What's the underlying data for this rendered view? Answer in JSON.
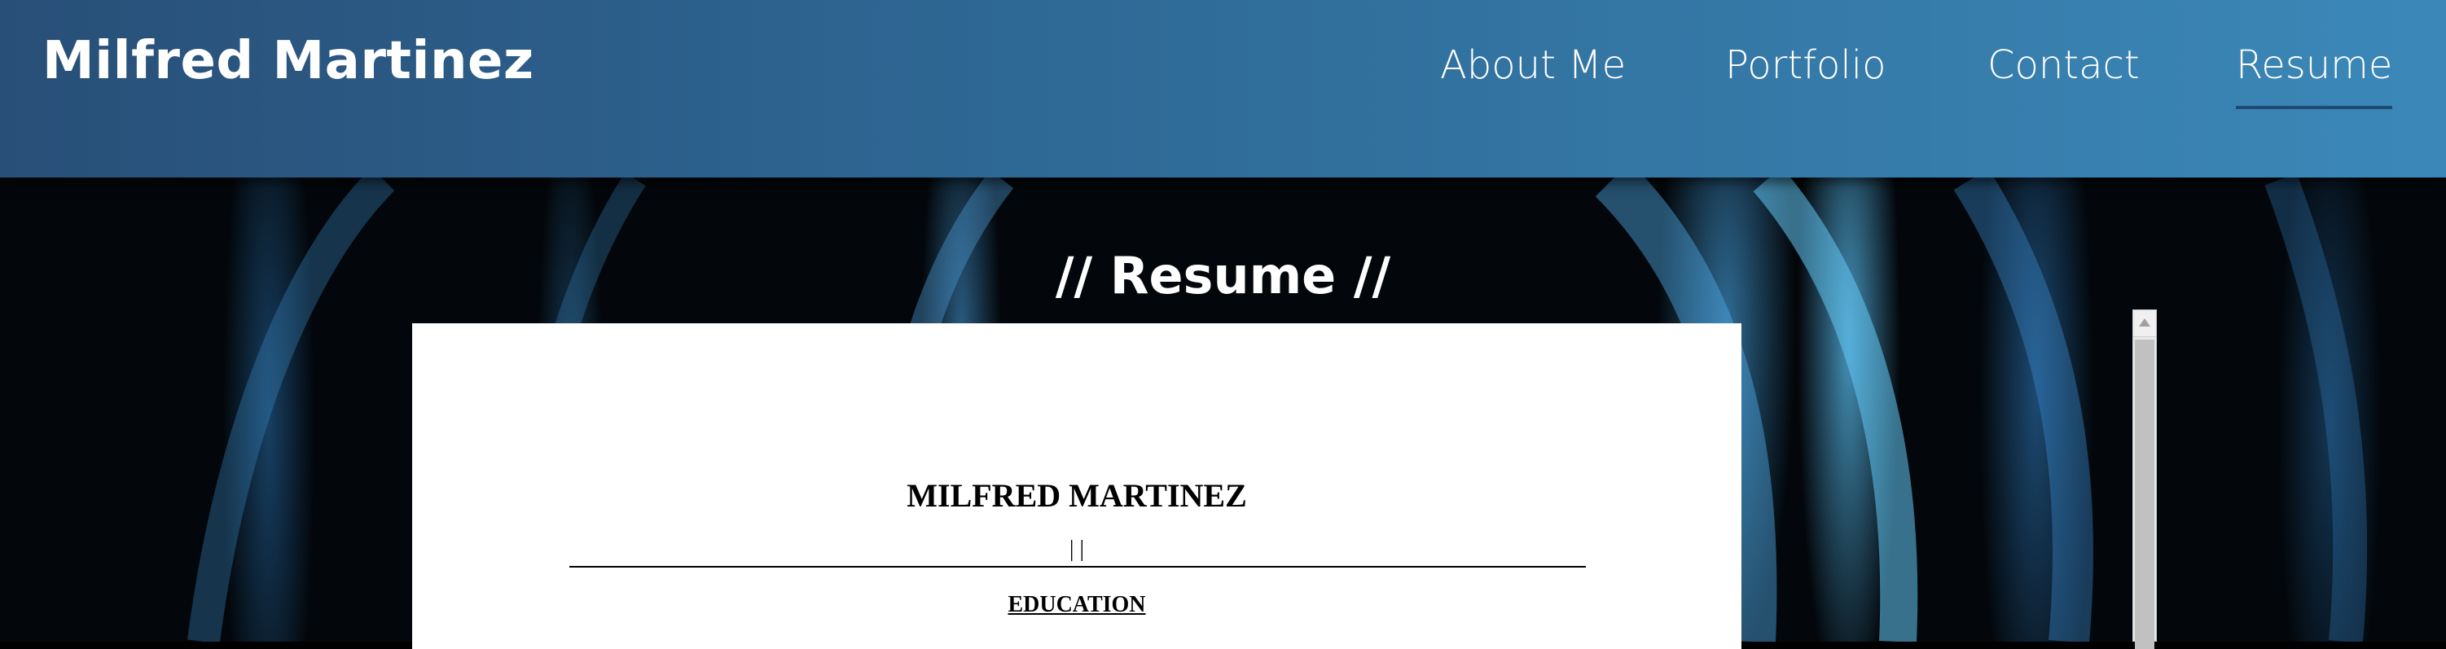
{
  "header": {
    "brand": "Milfred Martinez",
    "nav": [
      {
        "label": "About Me",
        "active": false
      },
      {
        "label": "Portfolio",
        "active": false
      },
      {
        "label": "Contact",
        "active": false
      },
      {
        "label": "Resume",
        "active": true
      }
    ]
  },
  "main": {
    "section_title": "// Resume //"
  },
  "resume_doc": {
    "name": "MILFRED MARTINEZ",
    "contact_line": "| |",
    "first_heading": "EDUCATION"
  },
  "colors": {
    "header_start": "#284f78",
    "header_end": "#3b88b8",
    "active_underline": "#1f4a74",
    "background": "#03070b"
  },
  "icons": {
    "scroll_up": "triangle-up-icon"
  }
}
